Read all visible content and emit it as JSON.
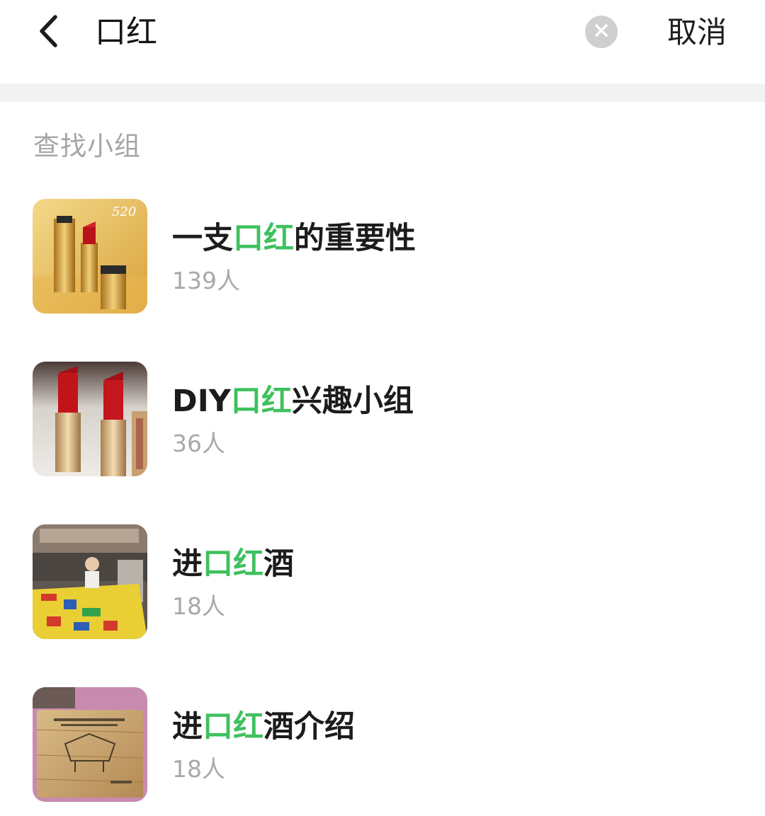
{
  "header": {
    "search_query": "口红",
    "cancel_label": "取消",
    "back_icon": "chevron-left-icon",
    "clear_icon": "close-icon"
  },
  "section": {
    "title": "查找小组"
  },
  "colors": {
    "highlight": "#3ec15e",
    "muted": "#a9a9a9",
    "divider": "#f2f2f2"
  },
  "groups": [
    {
      "name_prefix": "一支",
      "name_highlight": "口红",
      "name_suffix": "的重要性",
      "member_count": "139人",
      "thumb": "gold-lipstick-image"
    },
    {
      "name_prefix": "DIY",
      "name_highlight": "口红",
      "name_suffix": "兴趣小组",
      "member_count": "36人",
      "thumb": "red-lipstick-image"
    },
    {
      "name_prefix": "进",
      "name_highlight": "口红",
      "name_suffix": "酒",
      "member_count": "18人",
      "thumb": "child-play-area-image"
    },
    {
      "name_prefix": "进",
      "name_highlight": "口红",
      "name_suffix": "酒介绍",
      "member_count": "18人",
      "thumb": "wooden-box-image"
    }
  ]
}
